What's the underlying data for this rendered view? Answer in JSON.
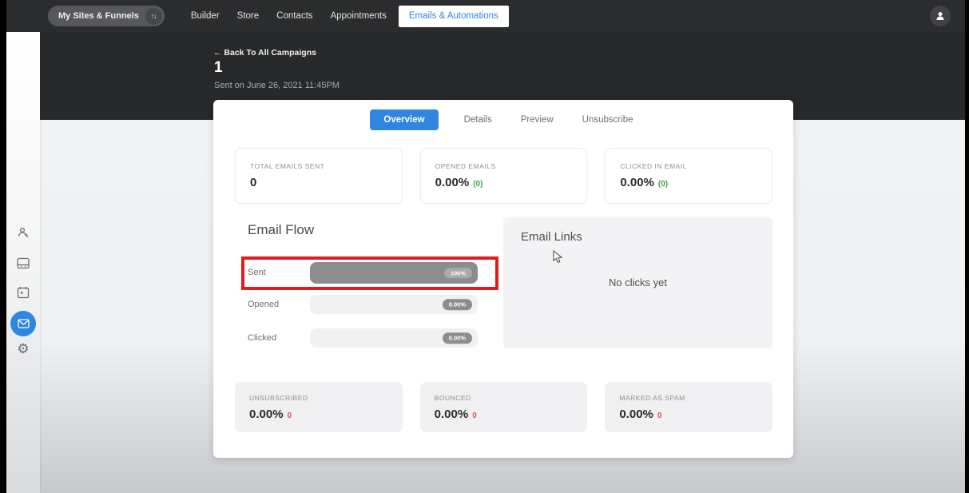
{
  "nav": {
    "sites_button": {
      "label": "My Sites & Funnels"
    },
    "items": [
      {
        "label": "Builder"
      },
      {
        "label": "Store"
      },
      {
        "label": "Contacts"
      },
      {
        "label": "Appointments"
      },
      {
        "label": "Emails & Automations"
      }
    ],
    "active_item": "Emails & Automations"
  },
  "icons": {
    "sort_arrows_glyph": "↑↓",
    "gear_glyph": "⚙",
    "sidebar": [
      "contacts-icon",
      "sites-icon",
      "calendar-icon",
      "email-icon",
      "gear-icon"
    ]
  },
  "header": {
    "back_link": "← Back To All Campaigns",
    "title": "1",
    "subtitle": "Sent on June 26, 2021 11:45PM"
  },
  "tabs": [
    {
      "label": "Overview",
      "active": true
    },
    {
      "label": "Details",
      "active": false
    },
    {
      "label": "Preview",
      "active": false
    },
    {
      "label": "Unsubscribe",
      "active": false
    }
  ],
  "stats_top": [
    {
      "label": "TOTAL EMAILS SENT",
      "value": "0",
      "suffix": ""
    },
    {
      "label": "OPENED EMAILS",
      "value": "0.00%",
      "suffix": "(0)"
    },
    {
      "label": "CLICKED IN EMAIL",
      "value": "0.00%",
      "suffix": "(0)"
    }
  ],
  "email_flow": {
    "title": "Email Flow",
    "rows": [
      {
        "label": "Sent",
        "badge": "100%",
        "fill_percent": 100,
        "highlighted": true
      },
      {
        "label": "Opened",
        "badge": "0.00%",
        "fill_percent": 0,
        "highlighted": false
      },
      {
        "label": "Clicked",
        "badge": "0.00%",
        "fill_percent": 0,
        "highlighted": false
      }
    ]
  },
  "email_links": {
    "title": "Email Links",
    "empty_message": "No clicks yet"
  },
  "stats_bottom": [
    {
      "label": "UNSUBSCRIBED",
      "value": "0.00%",
      "suffix": "0"
    },
    {
      "label": "BOUNCED",
      "value": "0.00%",
      "suffix": "0"
    },
    {
      "label": "MARKED AS SPAM",
      "value": "0.00%",
      "suffix": "0"
    }
  ],
  "colors": {
    "accent_blue": "#2e86e0",
    "highlight_red": "#e01d1d",
    "positive_green": "#43a047",
    "negative_red": "#d9534f",
    "nav_dark": "#2a2c2e",
    "header_dark": "#26282a",
    "bar_gray": "#8d8d8d"
  }
}
